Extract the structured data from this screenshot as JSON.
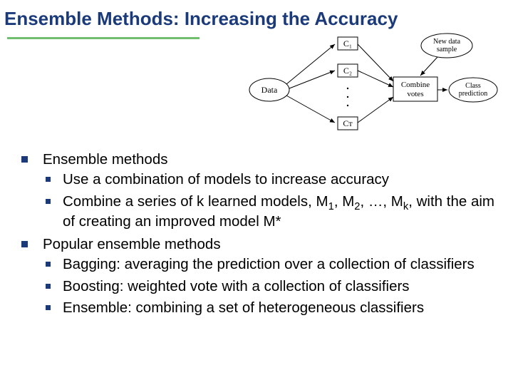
{
  "title": "Ensemble Methods: Increasing the Accuracy",
  "diagram": {
    "data_label": "Data",
    "classifiers": [
      "C₁",
      "C₂",
      "Cᴛ"
    ],
    "combine_label": "Combine votes",
    "new_sample_label": "New data sample",
    "prediction_label": "Class prediction"
  },
  "bullets": {
    "b1": "Ensemble methods",
    "b1_1": "Use a combination of models to increase accuracy",
    "b1_2_pre": "Combine a series of k learned models, M",
    "b1_2_s1": "1",
    "b1_2_m2": ", M",
    "b1_2_s2": "2",
    "b1_2_mid": ", …, M",
    "b1_2_sk": "k",
    "b1_2_post": ", with the aim of creating an improved model M*",
    "b2": "Popular ensemble methods",
    "b2_1": "Bagging: averaging the prediction over a collection of classifiers",
    "b2_2": "Boosting: weighted vote with a collection of classifiers",
    "b2_3": "Ensemble: combining a set of heterogeneous classifiers"
  }
}
